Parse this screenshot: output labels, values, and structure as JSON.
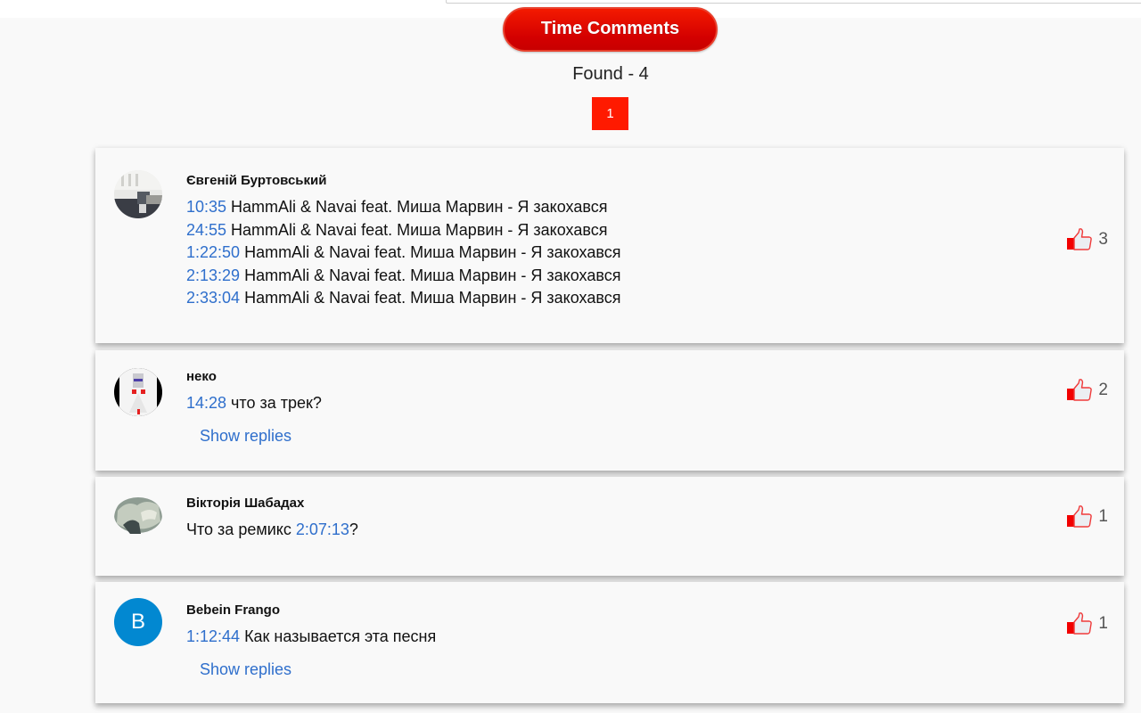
{
  "header": {
    "button_label": "Time Comments",
    "found_label": "Found - 4"
  },
  "pagination": {
    "current_page": "1",
    "active_color": "#ff1a00"
  },
  "colors": {
    "accent_red": "#e00000",
    "timestamp_blue": "#2f6fcc",
    "avatar_letter_bg": "#0288d1"
  },
  "comments": [
    {
      "author": "Євгеній Буртовський",
      "avatar_type": "photo",
      "lines": [
        {
          "time": "10:35",
          "text": " HammAli & Navai feat. Миша Марвин - Я закохався"
        },
        {
          "time": "24:55",
          "text": " HammAli & Navai feat. Миша Марвин - Я закохався"
        },
        {
          "time": "1:22:50",
          "text": " HammAli & Navai feat. Миша Марвин - Я закохався"
        },
        {
          "time": "2:13:29",
          "text": " HammAli & Navai feat. Миша Марвин - Я закохався"
        },
        {
          "time": "2:33:04",
          "text": " HammAli & Navai feat. Миша Марвин - Я закохався"
        }
      ],
      "likes": "3"
    },
    {
      "author": "неко",
      "avatar_type": "photo",
      "lines": [
        {
          "time": "14:28",
          "text": " что за трек?"
        }
      ],
      "show_replies": "Show replies",
      "likes": "2"
    },
    {
      "author": "Вікторія Шабадах",
      "avatar_type": "photo",
      "lines": [
        {
          "prefix": "Что за ремикс ",
          "time": "2:07:13",
          "suffix": "?"
        }
      ],
      "likes": "1"
    },
    {
      "author": "Bebein Frango",
      "avatar_type": "letter",
      "avatar_letter": "B",
      "lines": [
        {
          "time": "1:12:44",
          "text": " Как называется эта песня"
        }
      ],
      "show_replies": "Show replies",
      "likes": "1"
    }
  ],
  "icons": {
    "like": "thumbs-up-icon"
  }
}
